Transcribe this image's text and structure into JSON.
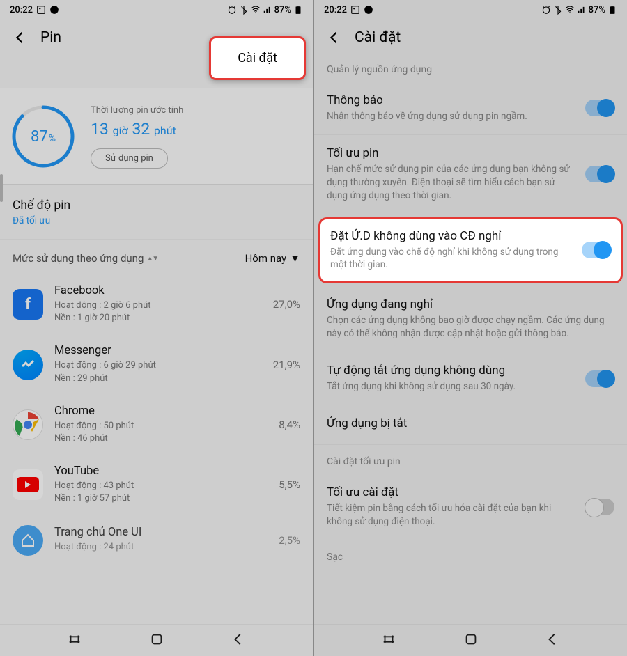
{
  "status": {
    "time": "20:22",
    "battery_pct": "87%"
  },
  "left": {
    "title": "Pin",
    "settings_popup": "Cài đặt",
    "battery": {
      "pct": "87",
      "pct_unit": "%",
      "est_label": "Thời lượng pin ước tính",
      "hours": "13",
      "hours_unit": "giờ",
      "minutes": "32",
      "minutes_unit": "phút",
      "usage_btn": "Sử dụng pin"
    },
    "mode": {
      "title": "Chế độ pin",
      "value": "Đã tối ưu"
    },
    "usage_label": "Mức sử dụng theo ứng dụng",
    "period": "Hôm nay",
    "apps": [
      {
        "name": "Facebook",
        "line1": "Hoạt động : 2 giờ 6 phút",
        "line2": "Nền : 1 giờ 20 phút",
        "pct": "27,0%"
      },
      {
        "name": "Messenger",
        "line1": "Hoạt động : 6 giờ 29 phút",
        "line2": "Nền : 29 phút",
        "pct": "21,9%"
      },
      {
        "name": "Chrome",
        "line1": "Hoạt động : 50 phút",
        "line2": "Nền : 46 phút",
        "pct": "8,4%"
      },
      {
        "name": "YouTube",
        "line1": "Hoạt động : 43 phút",
        "line2": "Nền : 1 giờ 57 phút",
        "pct": "5,5%"
      },
      {
        "name": "Trang chủ One UI",
        "line1": "Hoạt động : 24 phút",
        "line2": "",
        "pct": "2,5%"
      }
    ]
  },
  "right": {
    "title": "Cài đặt",
    "section1": "Quản lý nguồn ứng dụng",
    "items": [
      {
        "title": "Thông báo",
        "desc": "Nhận thông báo về ứng dụng sử dụng pin ngầm.",
        "toggle": true
      },
      {
        "title": "Tối ưu pin",
        "desc": "Hạn chế mức sử dụng pin của các ứng dụng bạn không sử dụng thường xuyên. Điện thoại sẽ tìm hiểu cách bạn sử dụng ứng dụng theo thời gian.",
        "toggle": true
      },
      {
        "title": "Đặt Ứ.D không dùng vào CĐ nghỉ",
        "desc": "Đặt ứng dụng vào chế độ nghỉ khi không sử dụng trong một thời gian.",
        "toggle": true,
        "highlighted": true
      },
      {
        "title": "Ứng dụng đang nghỉ",
        "desc": "Chọn các ứng dụng không bao giờ được chạy ngầm. Các ứng dụng này có thể không nhận được cập nhật hoặc gửi thông báo."
      },
      {
        "title": "Tự động tắt ứng dụng không dùng",
        "desc": "Tắt ứng dụng khi không sử dụng sau 30 ngày.",
        "toggle": true
      },
      {
        "title": "Ứng dụng bị tắt",
        "desc": ""
      }
    ],
    "section2": "Cài đặt tối ưu pin",
    "items2": [
      {
        "title": "Tối ưu cài đặt",
        "desc": "Tiết kiệm pin bằng cách tối ưu hóa cài đặt của bạn khi không sử dụng điện thoại.",
        "toggle": false
      }
    ],
    "section3": "Sạc"
  }
}
